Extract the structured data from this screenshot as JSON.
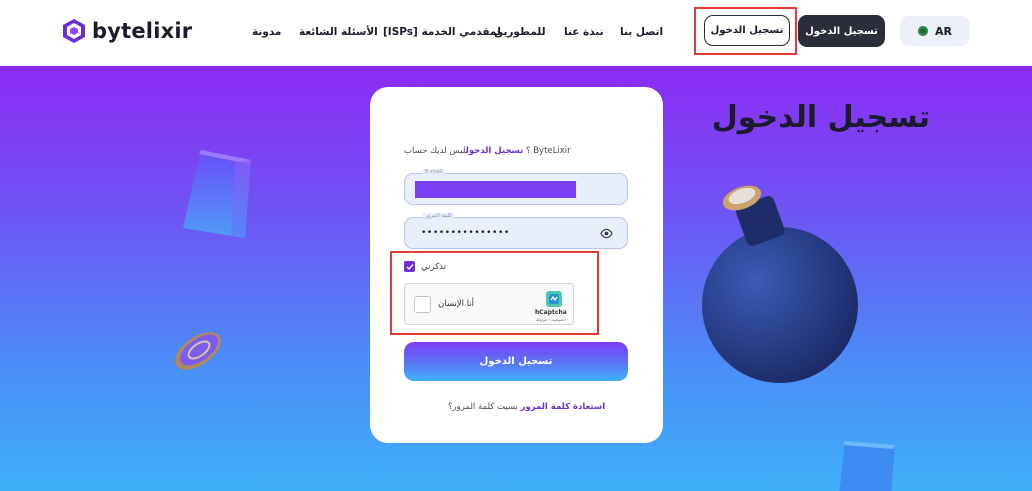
{
  "brand": {
    "name": "bytelixir"
  },
  "nav": {
    "items": [
      "مدونة",
      "الأسئلة الشائعة",
      "[ISPs] لمقدمي الخدمة",
      "للمطورين",
      "نبذة عنا",
      "اتصل بنا"
    ]
  },
  "header": {
    "login_outline_label": "تسجيل الدخول",
    "login_dark_label": "تسجيل الدخول",
    "language": "AR"
  },
  "login": {
    "title": "تسجيل الدخول",
    "no_account_text": "ليس لديك حساب ByteLixir",
    "no_account_link": "تسجيل الدخول",
    "no_account_suffix": "؟",
    "email_label": "E-mail",
    "password_label": "كلمة المرور",
    "password_value": "•••••••••••••••",
    "remember_label": "تذكرني",
    "remember_checked": true,
    "captcha_label": "أنا الإنسان",
    "captcha_brand": "hCaptcha",
    "captcha_links": "خصوصية - شروط",
    "submit_label": "تسجيل الدخول",
    "forgot_text": "نسيت كلمة المرور؟",
    "forgot_link": "استعادة كلمة المرور"
  },
  "colors": {
    "accent": "#6a2fd8",
    "highlight": "#e53935",
    "dark_button": "#2c2d3a"
  }
}
